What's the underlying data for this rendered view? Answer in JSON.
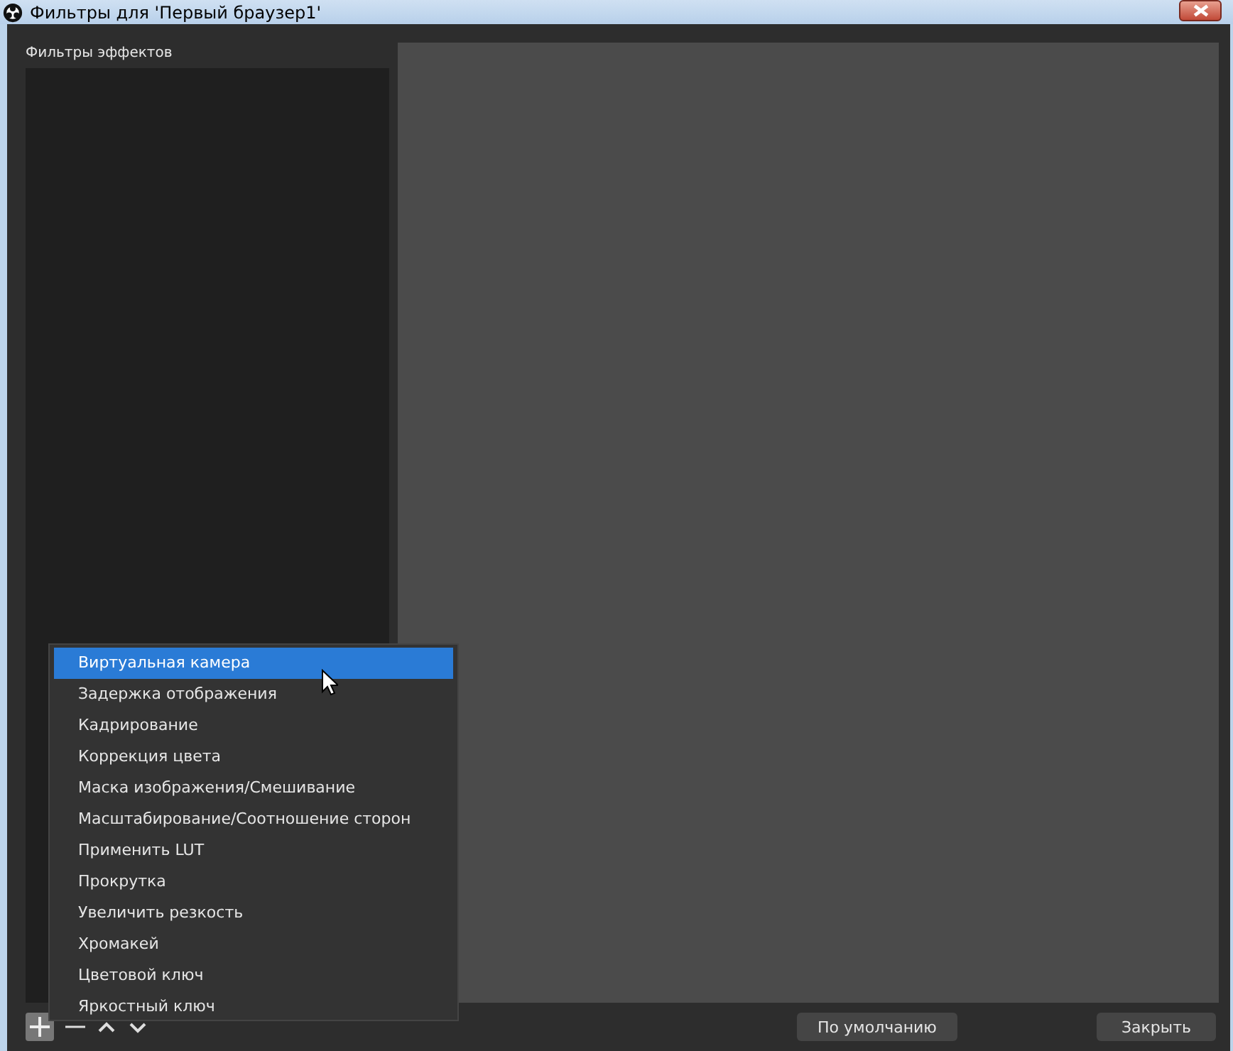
{
  "window": {
    "title": "Фильтры для 'Первый браузер1'"
  },
  "effects_label": "Фильтры эффектов",
  "menu": [
    {
      "label": "Виртуальная камера",
      "selected": true
    },
    {
      "label": "Задержка отображения",
      "selected": false
    },
    {
      "label": "Кадрирование",
      "selected": false
    },
    {
      "label": "Коррекция цвета",
      "selected": false
    },
    {
      "label": "Маска изображения/Смешивание",
      "selected": false
    },
    {
      "label": "Масштабирование/Соотношение сторон",
      "selected": false
    },
    {
      "label": "Применить LUT",
      "selected": false
    },
    {
      "label": "Прокрутка",
      "selected": false
    },
    {
      "label": "Увеличить резкость",
      "selected": false
    },
    {
      "label": "Хромакей",
      "selected": false
    },
    {
      "label": "Цветовой ключ",
      "selected": false
    },
    {
      "label": "Яркостный ключ",
      "selected": false
    }
  ],
  "buttons": [
    {
      "label": "По умолчанию"
    },
    {
      "label": "Закрыть"
    }
  ]
}
